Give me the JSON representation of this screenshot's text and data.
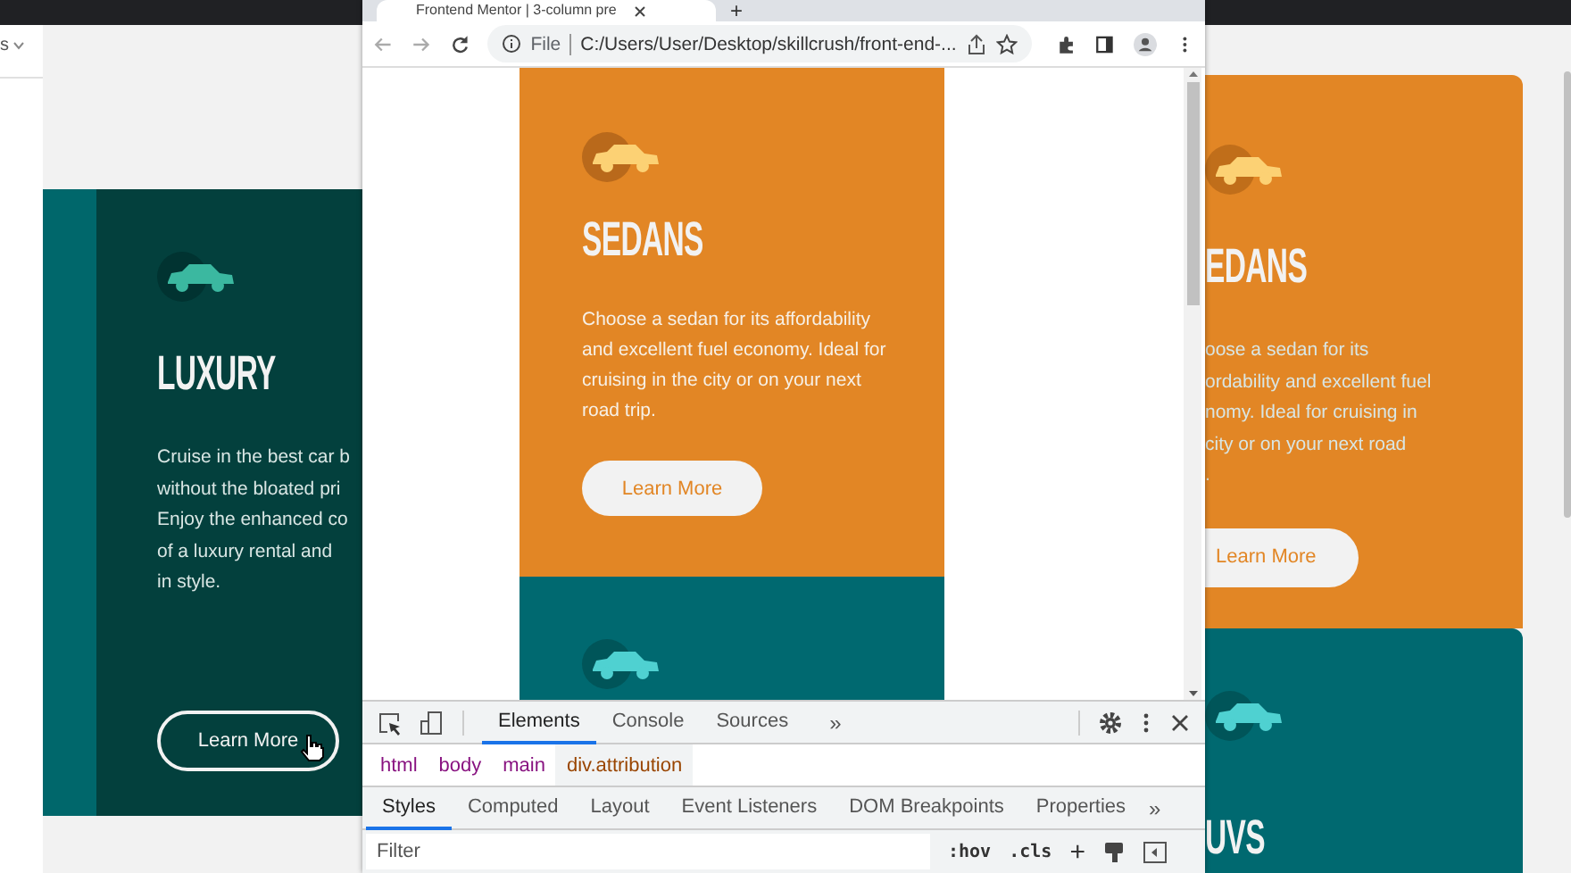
{
  "top_bar": {
    "dropdown_label": "s"
  },
  "background_page": {
    "luxury_card": {
      "title": "LUXURY",
      "lines": [
        "Cruise in the best car b",
        "without the bloated pri",
        "Enjoy the enhanced co",
        "of a luxury rental and",
        "in style."
      ],
      "button": "Learn More"
    },
    "sedans_card": {
      "title": "EDANS",
      "lines": [
        "oose a sedan for its",
        "ordability and excellent fuel",
        "nomy. Ideal for cruising in",
        "city or on your next road",
        "."
      ],
      "button": "Learn More"
    },
    "suvs_card": {
      "title": "UVS"
    }
  },
  "browser": {
    "tab_title": "Frontend Mentor | 3-column pre",
    "new_tab": "+",
    "address_scheme": "File",
    "address": "C:/Users/User/Desktop/skillcrush/front-end-...",
    "page": {
      "card": {
        "title": "SEDANS",
        "text": "Choose a sedan for its affordability and excellent fuel economy. Ideal for cruising in the city or on your next road trip.",
        "button": "Learn More"
      }
    },
    "devtools": {
      "tabs": [
        {
          "label": "Elements",
          "selected": true
        },
        {
          "label": "Console",
          "selected": false
        },
        {
          "label": "Sources",
          "selected": false
        }
      ],
      "more_tabs": "»",
      "breadcrumbs": [
        {
          "label": "html",
          "selected": false
        },
        {
          "label": "body",
          "selected": false
        },
        {
          "label": "main",
          "selected": false
        },
        {
          "label": "div.attribution",
          "selected": true
        }
      ],
      "panes": [
        {
          "label": "Styles",
          "selected": true
        },
        {
          "label": "Computed",
          "selected": false
        },
        {
          "label": "Layout",
          "selected": false
        },
        {
          "label": "Event Listeners",
          "selected": false
        },
        {
          "label": "DOM Breakpoints",
          "selected": false
        },
        {
          "label": "Properties",
          "selected": false
        }
      ],
      "more_panes": "»",
      "filter_placeholder": "Filter",
      "hov": ":hov",
      "cls": ".cls",
      "add": "+"
    }
  }
}
